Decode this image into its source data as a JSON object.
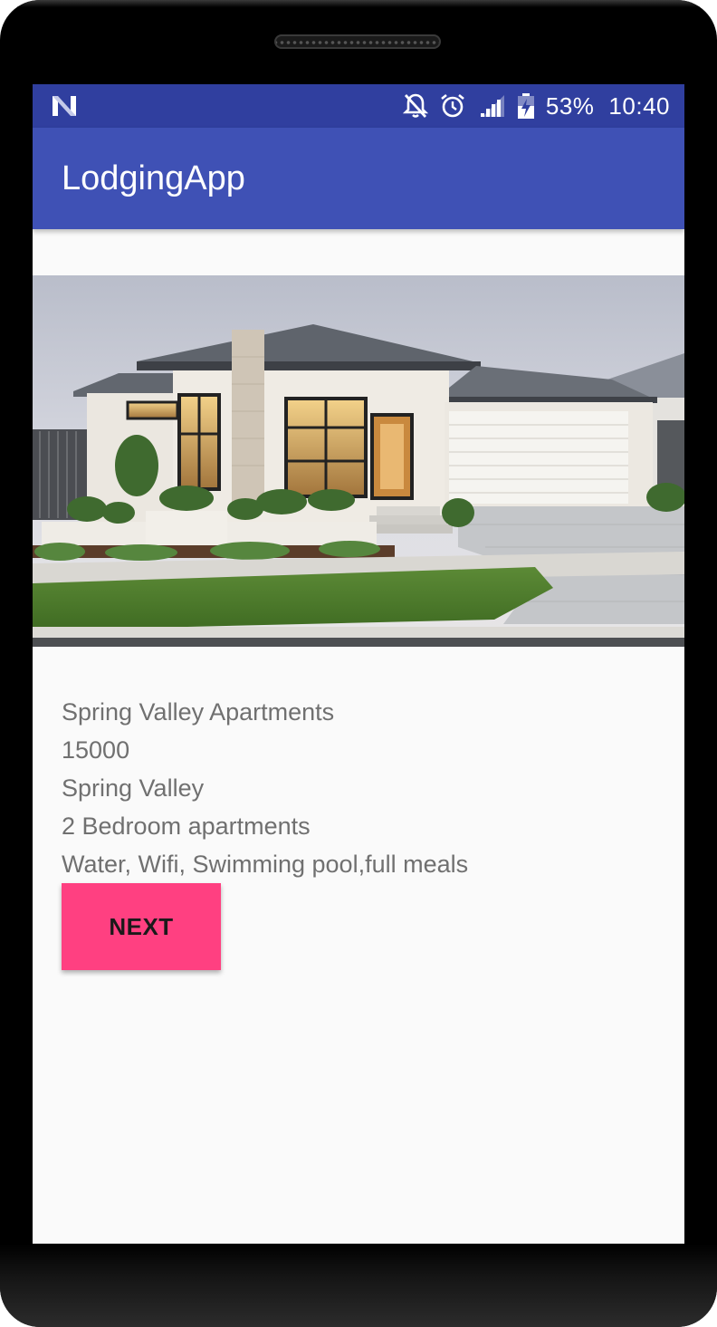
{
  "status_bar": {
    "notification_icon": "n-logo-icon",
    "icons": [
      "notifications-off-icon",
      "alarm-icon",
      "signal-icon",
      "battery-charging-icon"
    ],
    "battery_percent": "53%",
    "time": "10:40"
  },
  "app_bar": {
    "title": "LodgingApp"
  },
  "listing": {
    "image": "house-photo",
    "name": "Spring Valley Apartments",
    "price": "15000",
    "location": "Spring Valley",
    "type": "2 Bedroom apartments",
    "amenities": "Water, Wifi, Swimming pool,full meals"
  },
  "actions": {
    "next_label": "NEXT"
  },
  "colors": {
    "status_bar": "#303f9f",
    "app_bar": "#3f51b5",
    "accent": "#ff4081",
    "background": "#fafafa",
    "detail_text": "#707070"
  }
}
